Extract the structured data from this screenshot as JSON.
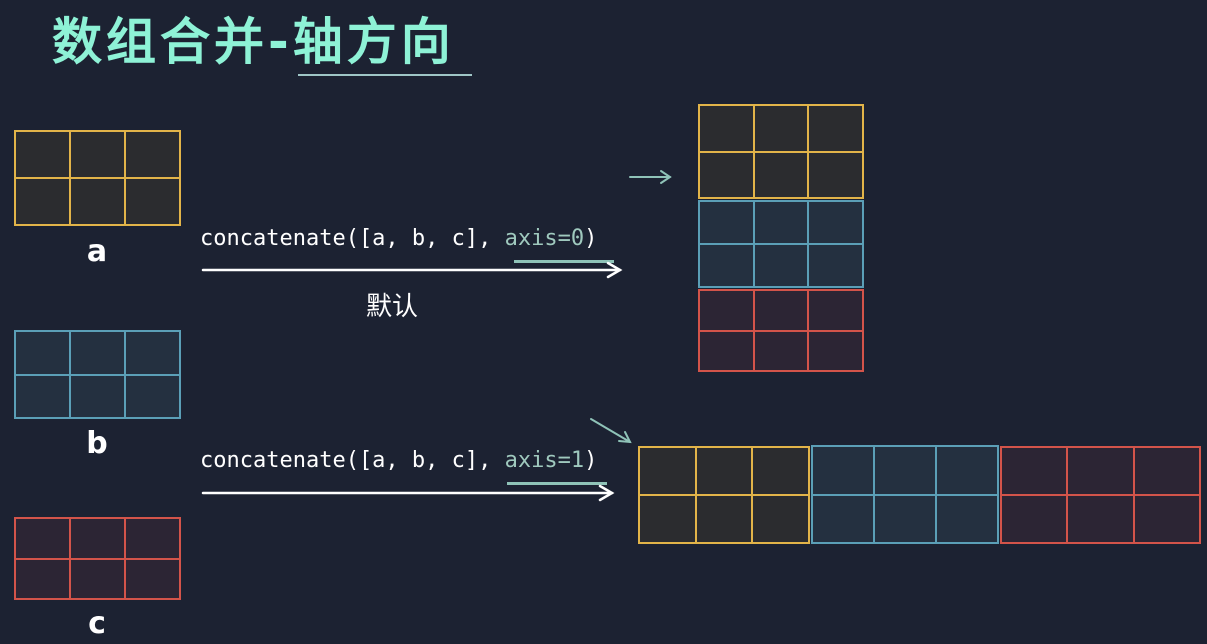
{
  "title": "数组合并-轴方向",
  "arrays": {
    "a": {
      "label": "a",
      "color": "#e2b449"
    },
    "b": {
      "label": "b",
      "color": "#5b9fb7"
    },
    "c": {
      "label": "c",
      "color": "#d3544a"
    }
  },
  "ops": [
    {
      "code_prefix": "concatenate([a, b, c], ",
      "axis_text": "axis=0",
      "code_suffix": ")",
      "note": "默认"
    },
    {
      "code_prefix": "concatenate([a, b, c], ",
      "axis_text": "axis=1",
      "code_suffix": ")"
    }
  ]
}
